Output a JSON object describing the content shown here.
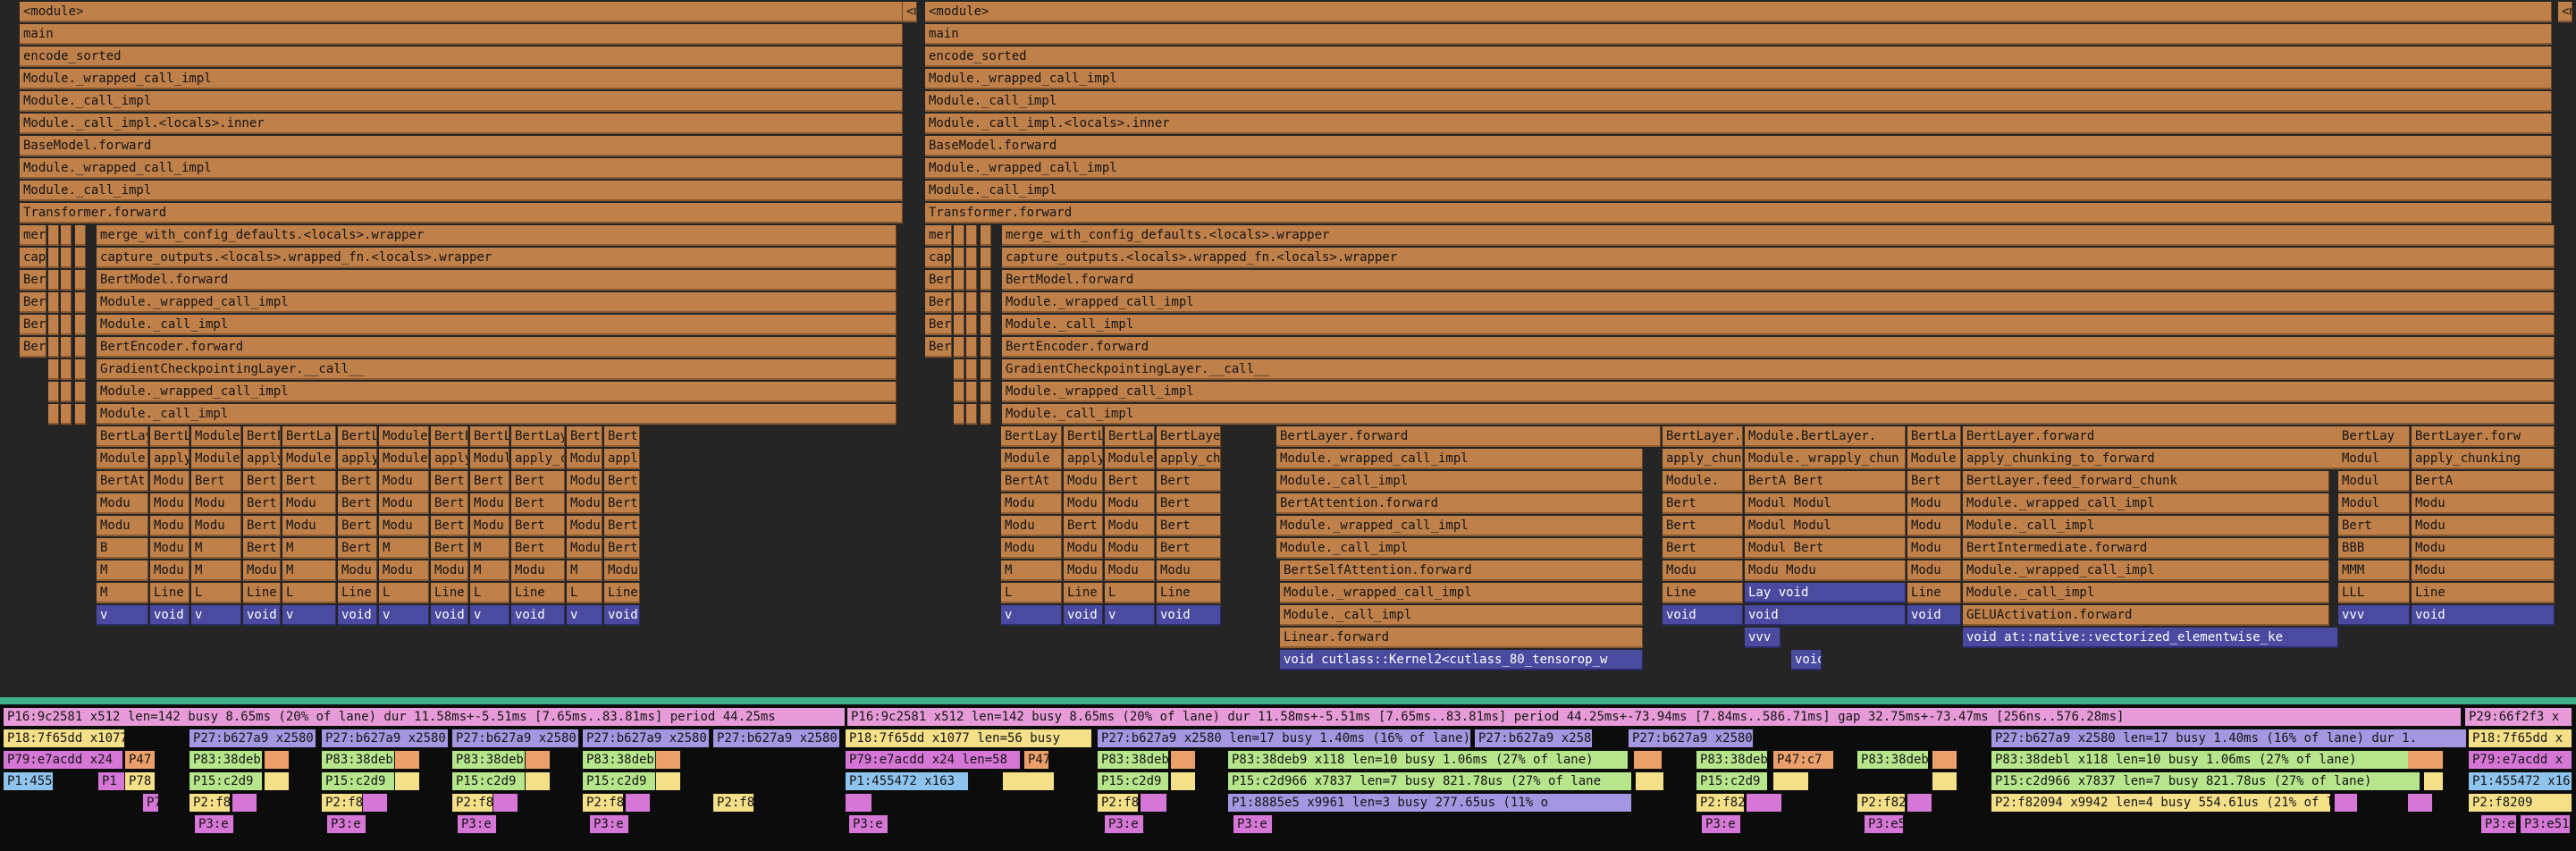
{
  "colors": {
    "frame": "#c0804a",
    "kernel": "#4a4aa0",
    "pink": "#e79ad8",
    "yellow": "#f5e08a",
    "purple": "#a596e2",
    "green": "#b6e58c",
    "lightblue": "#8ec4ee",
    "magenta": "#d676d6",
    "orange": "#eb9f6a",
    "separator": "#3bb08a"
  },
  "flamegraph": {
    "stack": [
      "<module>",
      "main",
      "encode_sorted",
      "Module._wrapped_call_impl",
      "Module._call_impl",
      "Module._call_impl.<locals>.inner",
      "BaseModel.forward",
      "Module._wrapped_call_impl",
      "Module._call_impl",
      "Transformer.forward"
    ],
    "inner_stack": [
      "merge_with_config_defaults.<locals>.wrapper",
      "capture_outputs.<locals>.wrapped_fn.<locals>.wrapper",
      "BertModel.forward",
      "Module._wrapped_call_impl",
      "Module._call_impl",
      "BertEncoder.forward",
      "GradientCheckpointingLayer.__call__",
      "Module._wrapped_call_impl",
      "Module._call_impl"
    ],
    "side_labels": [
      "merge",
      "capture",
      "Bert",
      "Bert",
      "Bert",
      "Bert"
    ],
    "tiny_labels": {
      "module_left": "<m",
      "module_right": "<mo"
    },
    "layer_cols_a": [
      [
        "BertLayer",
        "Module._",
        "BertAt",
        "Modu",
        "Modu",
        "B",
        "M",
        "M",
        "v"
      ],
      [
        "BertLayer",
        "apply_chu",
        "Modu",
        "Modu",
        "Modu",
        "Modu",
        "Modu",
        "Line",
        "void"
      ],
      [
        "Module",
        "Module",
        "Bert",
        "Modu",
        "Modu",
        "M",
        "M",
        "L",
        "v"
      ],
      [
        "BertLa",
        "apply_chu",
        "Bert",
        "Bert",
        "Bert",
        "Bert",
        "Modu",
        "Line",
        "void"
      ],
      [
        "BertLa",
        "Module",
        "Bert",
        "Modu",
        "Modu",
        "M",
        "M",
        "L",
        "v"
      ],
      [
        "BertLayer",
        "apply_chu",
        "Bert",
        "Bert",
        "Bert",
        "Bert",
        "Modu",
        "Line",
        "void"
      ],
      [
        "Module",
        "Module",
        "Modu",
        "Modu",
        "Modu",
        "M",
        "Modu",
        "L",
        "v"
      ],
      [
        "BertLayer",
        "apply_chu",
        "Bert",
        "Bert",
        "Bert",
        "Bert",
        "Modu",
        "Line",
        "void"
      ],
      [
        "BertLa",
        "Module",
        "Bert",
        "Modu",
        "Modu",
        "M",
        "M",
        "L",
        "v"
      ],
      [
        "BertLayer",
        "apply_chu",
        "Bert",
        "Bert",
        "Bert",
        "Bert",
        "Modu",
        "Line",
        "void"
      ],
      [
        "BertLayer",
        "Module",
        "Modu",
        "Modu",
        "Modu",
        "Modu",
        "M",
        "L",
        "v"
      ],
      [
        "BertLayer",
        "apply_chu",
        "Bert",
        "Bert",
        "Bert",
        "Bert",
        "Modu",
        "Line",
        "void"
      ]
    ],
    "layer_cols_b": [
      [
        "BertLay",
        "Module",
        "BertAt",
        "Modu",
        "Modu",
        "Modu",
        "M",
        "L",
        "v"
      ],
      [
        "BertLayer",
        "apply_chu",
        "Modu",
        "Modu",
        "Bert",
        "Modu",
        "Modu",
        "Line",
        "void"
      ],
      [
        "BertLa",
        "Module",
        "Bert",
        "Modu",
        "Modu",
        "Modu",
        "Modu",
        "L",
        "v"
      ],
      [
        "BertLayer",
        "apply_chu",
        "Bert",
        "Bert",
        "Bert",
        "Bert",
        "Modu",
        "Line",
        "void"
      ]
    ],
    "big_attention": [
      "BertLayer.forward",
      "Module._wrapped_call_impl",
      "Module._call_impl",
      "BertAttention.forward",
      "Module._wrapped_call_impl",
      "Module._call_impl",
      "BertSelfAttention.forward",
      "Module._wrapped_call_impl",
      "Module._call_impl",
      "Linear.forward",
      "void cutlass::Kernel2<cutlass_80_tensorop_w"
    ],
    "big_ffn": [
      "BertLayer.forward",
      "apply_chunking_to_forward",
      "BertLayer.feed_forward_chunk",
      "Module._wrapped_call_impl",
      "Module._call_impl",
      "BertIntermediate.forward",
      "Module._wrapped_call_impl",
      "Module._call_impl",
      "GELUActivation.forward",
      "void at::native::vectorized_elementwise_ke"
    ],
    "mid_a": [
      "BertLayer.",
      "apply_chun",
      "Module.",
      "Bert",
      "Bert",
      "Bert",
      "Modu",
      "Line",
      "void"
    ],
    "mid_b": [
      "Module.BertLayer.",
      "Module._wrapply_chun",
      "BertA Bert",
      "Modul Modul",
      "Modul Modul",
      "Modul Bert",
      "Modu Modu",
      "Lay void",
      "void"
    ],
    "mid_c": [
      "BertLa",
      "Module",
      "Bert",
      "Modu",
      "Modu",
      "Modu",
      "Modu",
      "Line",
      "void"
    ],
    "right_cols": [
      [
        "BertLay",
        "Modul",
        "Modul",
        "Modul",
        "Bert",
        "BBB",
        "MMM",
        "LLL",
        "vvv"
      ],
      [
        "BertLayer.forw",
        "apply_chunking",
        "BertA",
        "Modu",
        "Modu",
        "Modu",
        "Modu",
        "Line",
        "void"
      ]
    ],
    "extra_labels": {
      "vvv": "vvv",
      "void_low": "void",
      "lay": "Lay"
    }
  },
  "lanes": {
    "row1": [
      "P16:9c2581 x512 len=142  busy 8.65ms (20% of lane)  dur 11.58ms+-5.51ms [7.65ms..83.81ms]  period 44.25ms",
      "P16:9c2581 x512 len=142  busy 8.65ms (20% of lane)  dur 11.58ms+-5.51ms [7.65ms..83.81ms]  period 44.25ms+-73.94ms [7.84ms..586.71ms]  gap 32.75ms+-73.47ms [256ns..576.28ms]",
      "P29:66f2f3 x"
    ],
    "row2": [
      "P18:7f65dd x1077 l",
      "P27:b627a9 x2580",
      "P27:b627a9 x2580",
      "P27:b627a9 x2580",
      "P27:b627a9 x2580",
      "P27:b627a9 x2580",
      "P18:7f65dd x1077 len=56  busy",
      "P27:b627a9 x2580 len=17  busy 1.40ms (16% of lane)  dur 1",
      "P27:b627a9 x2580 len",
      "P27:b627a9 x2580",
      "P27:b627a9 x2580 len=17  busy 1.40ms (16% of lane)  dur 1.",
      "P18:7f65dd x"
    ],
    "row3": [
      "P79:e7acdd x24",
      "P47",
      "P83:38deb",
      "P83:38deb",
      "P83:38deb",
      "P83:38deb",
      "P79:e7acdd x24 len=58",
      "P47",
      "P83:38deb",
      "P83:38deb9 x118 len=10  busy 1.06ms (27% of lane)",
      "P83:38deb",
      "P47:c7",
      "P83:38deb",
      "P83:38debl x118 len=10  busy 1.06ms (27% of lane)",
      "P79:e7acdd x"
    ],
    "row4": [
      "P1:455",
      "P15:c2d9",
      "P15:c2d9",
      "P15:c2d9",
      "P15:c2d9",
      "P1:455472 x163",
      "P15:c2d9",
      "P15:c2d966 x7837 len=7  busy 821.78us (27% of lane",
      "P15:c2d9",
      "P15:c2d966 x7837 len=7  busy 821.78us (27% of lane)",
      "P1:455472 x16"
    ],
    "row5": [
      "P2:f8",
      "P2:f8",
      "P2:f8",
      "P2:f8",
      "P2:f8",
      "P2:f8",
      "P1:8885e5 x9961 len=3  busy 277.65us (11% o",
      "P2:f82",
      "P2:f82",
      "P2:f82094 x9942 len=4  busy 554.61us (21% of la",
      "P2:f8209"
    ],
    "row6": [
      "P3:e",
      "P3:e",
      "P3:e",
      "P3:e",
      "P3:e",
      "P3:e",
      "P3:e",
      "P3:e",
      "P3:e5",
      "P3:e5",
      "P3:e51f"
    ],
    "small": {
      "p1": "P1",
      "p3": "P3",
      "p7": "P7",
      "p78": "P78",
      "p11": "P11",
      "p4": "P4"
    }
  }
}
